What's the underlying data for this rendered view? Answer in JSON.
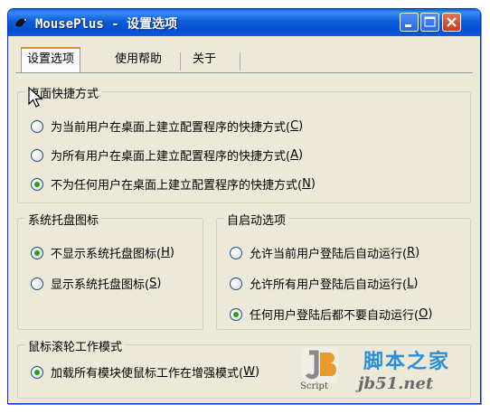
{
  "window": {
    "title": "MousePlus - 设置选项"
  },
  "tabs": [
    {
      "label": "设置选项",
      "active": true
    },
    {
      "label": "使用帮助",
      "active": false
    },
    {
      "label": "关于",
      "active": false
    }
  ],
  "desktop_shortcut": {
    "legend": "桌面快捷方式",
    "options": [
      {
        "label": "为当前用户在桌面上建立配置程序的快捷方式(",
        "hotkey": "C",
        "close": ")",
        "checked": false
      },
      {
        "label": "为所有用户在桌面上建立配置程序的快捷方式(",
        "hotkey": "A",
        "close": ")",
        "checked": false
      },
      {
        "label": "不为任何用户在桌面上建立配置程序的快捷方式(",
        "hotkey": "N",
        "close": ")",
        "checked": true
      }
    ]
  },
  "tray_icon": {
    "legend": "系统托盘图标",
    "options": [
      {
        "label": "不显示系统托盘图标(",
        "hotkey": "H",
        "close": ")",
        "checked": true
      },
      {
        "label": "显示系统托盘图标(",
        "hotkey": "S",
        "close": ")",
        "checked": false
      }
    ]
  },
  "autostart": {
    "legend": "自启动选项",
    "options": [
      {
        "label": "允许当前用户登陆后自动运行(",
        "hotkey": "R",
        "close": ")",
        "checked": false
      },
      {
        "label": "允许所有用户登陆后自动运行(",
        "hotkey": "L",
        "close": ")",
        "checked": false
      },
      {
        "label": "任何用户登陆后都不要自动运行(",
        "hotkey": "O",
        "close": ")",
        "checked": true
      }
    ]
  },
  "wheel_mode": {
    "legend": "鼠标滚轮工作模式",
    "options": [
      {
        "label": "加载所有模块使鼠标工作在增强模式(",
        "hotkey": "W",
        "close": ")",
        "checked": true
      }
    ]
  },
  "watermark": {
    "script": "Script",
    "site_name": "脚本之家",
    "url": "jb51.net"
  },
  "colors": {
    "titlebar": "#0b5cd9",
    "window_bg": "#ece9d8",
    "close_button": "#c23d1d",
    "radio_dot": "#21a121",
    "tab_highlight": "#e68b2c"
  }
}
